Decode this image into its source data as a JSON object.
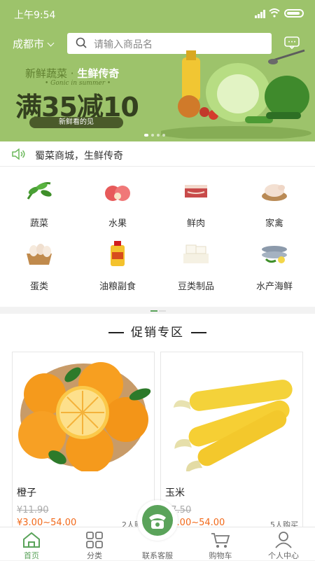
{
  "status_bar": {
    "time": "上午9:54"
  },
  "header": {
    "city": "成都市",
    "search_placeholder": "请输入商品名"
  },
  "banner": {
    "line1_a": "新鲜蔬菜 · ",
    "line1_b": "生鲜传奇",
    "line2": "• Gonic in summer •",
    "big": "满35减10",
    "pill": "新鲜看的见"
  },
  "notice": {
    "text": "蜀菜商城，生鲜传奇"
  },
  "categories": [
    {
      "label": "蔬菜",
      "icon": "vegetable-icon"
    },
    {
      "label": "水果",
      "icon": "fruit-icon"
    },
    {
      "label": "鲜肉",
      "icon": "meat-icon"
    },
    {
      "label": "家禽",
      "icon": "poultry-icon"
    },
    {
      "label": "蛋类",
      "icon": "egg-icon"
    },
    {
      "label": "油粮副食",
      "icon": "oil-icon"
    },
    {
      "label": "豆类制品",
      "icon": "tofu-icon"
    },
    {
      "label": "水产海鲜",
      "icon": "seafood-icon"
    }
  ],
  "promo": {
    "title": "促销专区"
  },
  "products": [
    {
      "name": "橙子",
      "old_price": "¥11.90",
      "price": "¥3.00~54.00",
      "buyers": "2人购买"
    },
    {
      "name": "玉米",
      "old_price": "¥7.50",
      "price": "¥3.00~54.00",
      "buyers": "5人购买"
    }
  ],
  "tabbar": [
    {
      "label": "首页",
      "icon": "home-icon",
      "active": true
    },
    {
      "label": "分类",
      "icon": "category-icon"
    },
    {
      "label": "联系客服",
      "icon": "phone-icon"
    },
    {
      "label": "购物车",
      "icon": "cart-icon"
    },
    {
      "label": "个人中心",
      "icon": "user-icon"
    }
  ],
  "colors": {
    "theme_green": "#9dc36b",
    "accent_green": "#5aa35a",
    "price_orange": "#f26a1b"
  }
}
